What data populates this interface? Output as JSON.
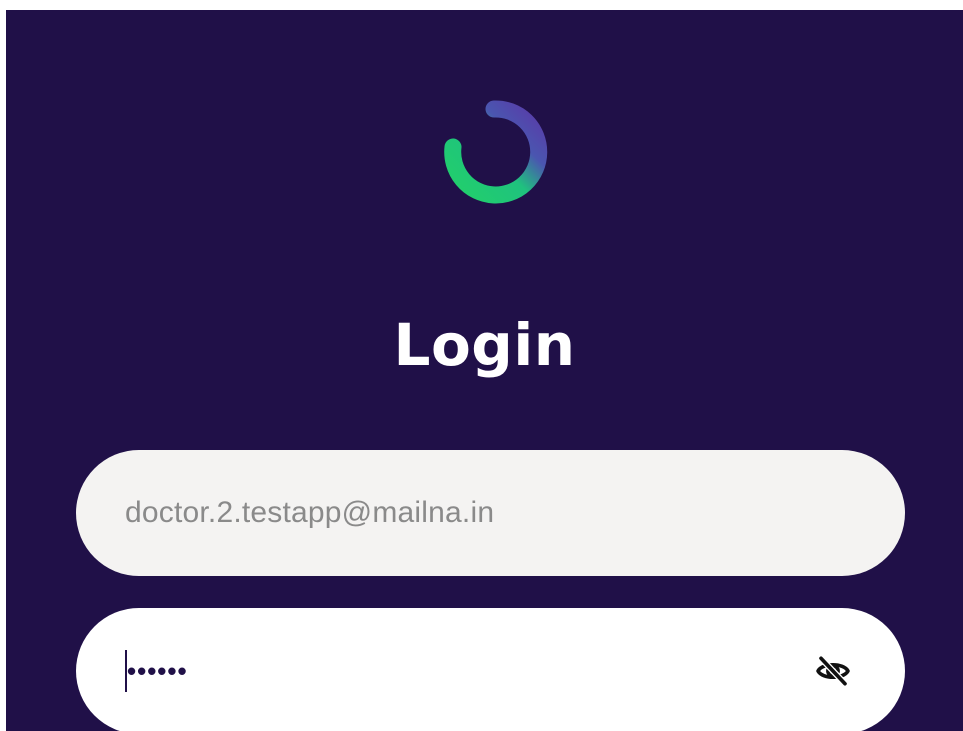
{
  "login": {
    "logo_icon": "ring-logo-icon",
    "title": "Login",
    "email": {
      "value": "doctor.2.testapp@mailna.in"
    },
    "password": {
      "masked_value": "••••••",
      "toggle_icon": "eye-off-icon"
    }
  },
  "colors": {
    "background": "#201048",
    "logo_green": "#22d06a",
    "logo_purple": "#5a3aa8",
    "email_field_bg": "#f4f3f2",
    "password_field_bg": "#ffffff"
  }
}
